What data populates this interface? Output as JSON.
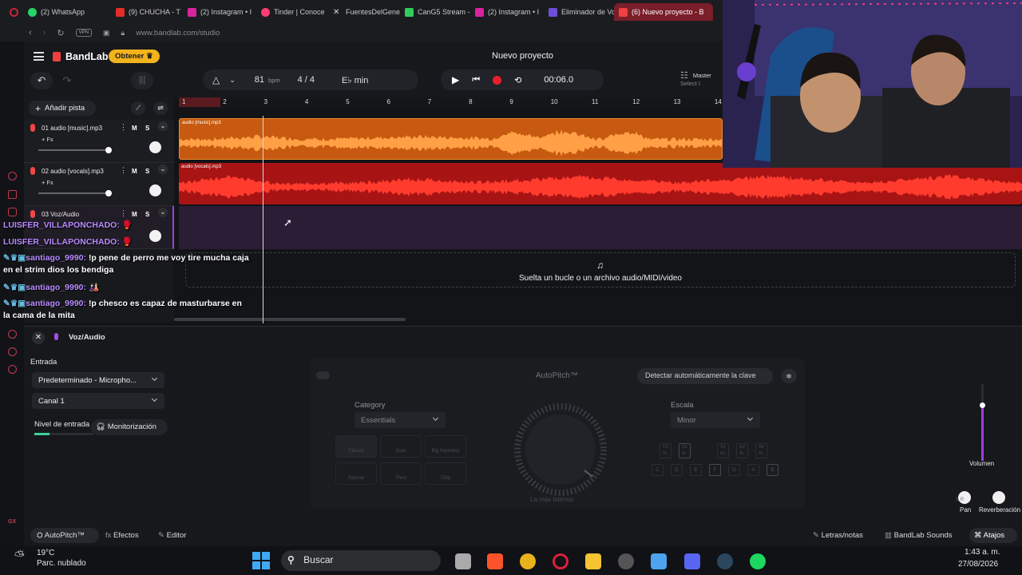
{
  "browser": {
    "tabs": [
      {
        "label": "",
        "color": "#c8253a"
      },
      {
        "label": "(2) WhatsApp",
        "color": "#25d366"
      },
      {
        "label": "(9) CHUCHA - T",
        "color": "#e52d27"
      },
      {
        "label": "(2) Instagram • I",
        "color": "#d6249f"
      },
      {
        "label": "Tinder | Conoce",
        "color": "#fe3c72"
      },
      {
        "label": "FuentesDelGener",
        "color": "#e6e6e6"
      },
      {
        "label": "CanG5 Stream -",
        "color": "#2fce5b"
      },
      {
        "label": "(2) Instagram • I",
        "color": "#d6249f"
      },
      {
        "label": "Eliminador de Vo",
        "color": "#6c4fd8"
      },
      {
        "label": "(6) Nuevo proyecto - B",
        "color": "#f04040"
      }
    ],
    "url": "www.bandlab.com/studio",
    "vpn": "VPN"
  },
  "app": {
    "brand": "BandLab",
    "get_button": "Obtener",
    "project_title": "Nuevo proyecto",
    "bpm_value": "81",
    "bpm_label": "bpm",
    "time_signature": "4 / 4",
    "key": "E♭ min",
    "time_code": "00:06.0",
    "master_label": "Master",
    "master_sub": "Select I",
    "add_track": "Añadir pista"
  },
  "ruler": [
    "1",
    "2",
    "3",
    "4",
    "5",
    "6",
    "7",
    "8",
    "9",
    "10",
    "11",
    "12",
    "13",
    "14"
  ],
  "tracks": [
    {
      "name": "01  audio [music].mp3",
      "clip": "audio [music].mp3",
      "fx": "+ Fx",
      "m": "M",
      "s": "S",
      "color": "#f27a1a"
    },
    {
      "name": "02  audio [vocals].mp3",
      "clip": "audio [vocals].mp3",
      "fx": "+ Fx",
      "m": "M",
      "s": "S",
      "color": "#e62323"
    },
    {
      "name": "03  Voz/Audio",
      "clip": "",
      "fx": "",
      "m": "M",
      "s": "S",
      "color": "#3a2447"
    }
  ],
  "chat": [
    {
      "user": "LUISFER_VILLAPONCHADO:",
      "msg": "🥊"
    },
    {
      "user": "LUISFER_VILLAPONCHADO:",
      "msg": "🥊"
    },
    {
      "user": "santiago_9990:",
      "msg": "!p pene de perro me voy tire mucha caja"
    },
    {
      "user": "",
      "msg": "en el strim dios los bendiga"
    },
    {
      "user": "santiago_9990:",
      "msg": "🎎"
    },
    {
      "user": "santiago_9990:",
      "msg": "!p chesco es capaz de masturbarse en"
    },
    {
      "user": "",
      "msg": "la cama de la mita"
    }
  ],
  "dropzone": "Suelta un bucle o un archivo audio/MIDI/video",
  "panel": {
    "title": "Voz/Audio",
    "input_label": "Entrada",
    "input_device": "Predeterminado - Micropho...",
    "channel": "Canal 1",
    "level_label": "Nivel de entrada",
    "monitor_button": "Monitorización",
    "autopitch_title": "AutoPitch™",
    "detect_key": "Detectar automáticamente la clave",
    "category_label": "Category",
    "category_value": "Essentials",
    "scale_label": "Escala",
    "scale_value": "Minor",
    "intensity_label": "La más intenso",
    "presets": [
      "Classic",
      "Duet",
      "Big Harmony",
      "Natural",
      "Third",
      "Chip"
    ],
    "keys_top": [
      "C♯ D♭",
      "D♯ E♭",
      "F♯ G♭",
      "G♯ A♭",
      "A♯ B♭"
    ],
    "keys_bottom": [
      "C",
      "D",
      "E",
      "F",
      "G",
      "A",
      "B"
    ],
    "volume_label": "Volumen",
    "pan_label": "Pan",
    "reverb_label": "Reverberación",
    "lr": "L R"
  },
  "bottombar": {
    "autopitch": "AutoPitch™",
    "effects": "Efectos",
    "editor": "Editor",
    "lyrics": "Letras/notas",
    "sounds": "BandLab Sounds",
    "shortcuts": "Atajos"
  },
  "taskbar": {
    "weather_temp": "19°C",
    "weather_desc": "Parc. nublado",
    "search": "Buscar",
    "time": "1:43 a. m.",
    "date": "27/08/2026"
  }
}
